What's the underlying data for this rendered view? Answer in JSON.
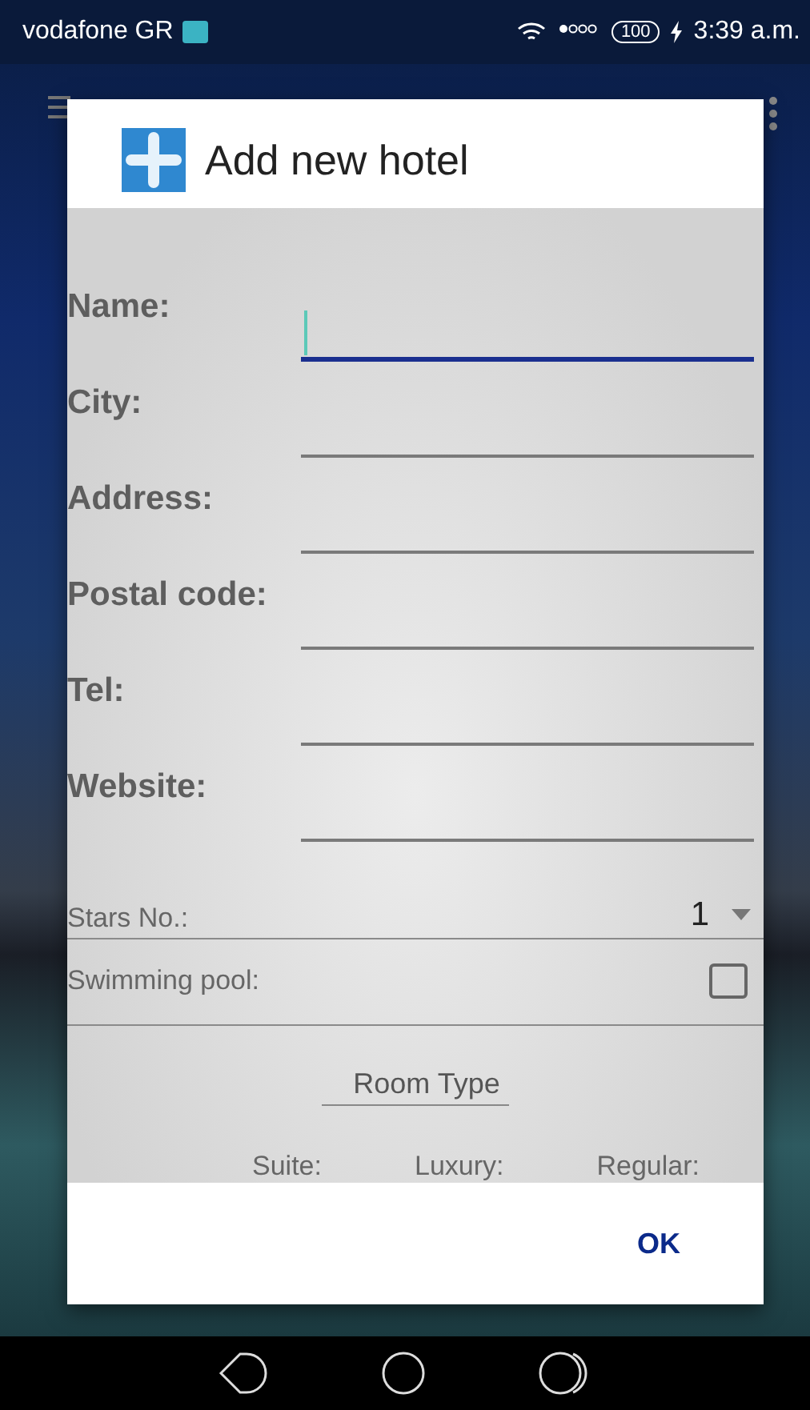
{
  "status_bar": {
    "carrier": "vodafone GR",
    "battery": "100",
    "time": "3:39 a.m."
  },
  "dialog": {
    "title": "Add new hotel",
    "fields": [
      {
        "label": "Name:",
        "focused": true
      },
      {
        "label": "City:",
        "focused": false
      },
      {
        "label": "Address:",
        "focused": false
      },
      {
        "label": "Postal code:",
        "focused": false
      },
      {
        "label": "Tel:",
        "focused": false
      },
      {
        "label": "Website:",
        "focused": false
      }
    ],
    "stars": {
      "label": "Stars No.:",
      "value": "1"
    },
    "swimming_pool": {
      "label": "Swimming pool:",
      "checked": false
    },
    "room_type": {
      "heading": "Room Type",
      "columns": [
        "Suite:",
        "Luxury:",
        "Regular:"
      ]
    },
    "buttons": [
      "OK"
    ]
  }
}
